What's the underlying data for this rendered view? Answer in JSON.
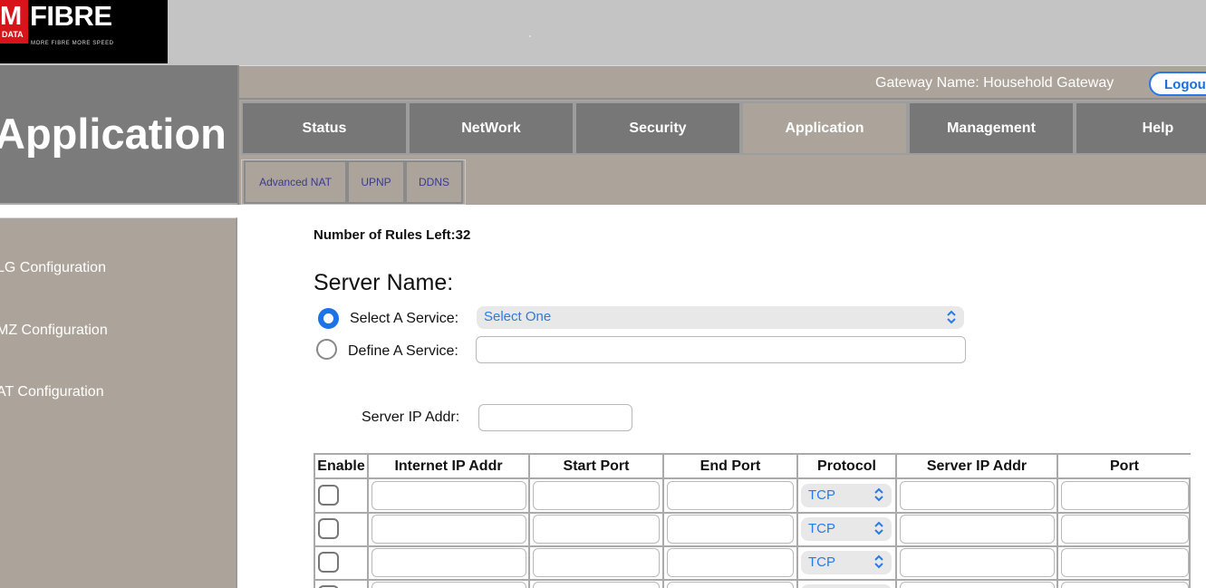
{
  "logo": {
    "brand_m": "M",
    "brand_fibre": "FIBRE",
    "brand_data": "DATA",
    "tagline": "MORE FIBRE MORE SPEED"
  },
  "header": {
    "page_title": "Application",
    "gateway_name": "Gateway Name: Household Gateway",
    "logout_label": "Logou"
  },
  "tabs": [
    {
      "label": "Status"
    },
    {
      "label": "NetWork"
    },
    {
      "label": "Security"
    },
    {
      "label": "Application"
    },
    {
      "label": "Management"
    },
    {
      "label": "Help"
    }
  ],
  "active_tab": "Application",
  "subtabs": [
    {
      "label": "Advanced NAT"
    },
    {
      "label": "UPNP"
    },
    {
      "label": "DDNS"
    }
  ],
  "sidebar": {
    "items": [
      {
        "label": "LG Configuration"
      },
      {
        "label": "MZ Configuration"
      },
      {
        "label": "AT Configuration"
      }
    ]
  },
  "form": {
    "rules_left": "Number of Rules Left:32",
    "server_name_heading": "Server Name:",
    "select_service_label": "Select A Service:",
    "select_service_value": "Select One",
    "define_service_label": "Define A Service:",
    "define_service_value": "",
    "server_ip_label": "Server IP Addr:",
    "server_ip_value": ""
  },
  "table": {
    "headers": [
      "Enable",
      "Internet IP Addr",
      "Start Port",
      "End Port",
      "Protocol",
      "Server IP Addr",
      "Port"
    ],
    "rows": [
      {
        "enabled": false,
        "protocol": "TCP"
      },
      {
        "enabled": false,
        "protocol": "TCP"
      },
      {
        "enabled": false,
        "protocol": "TCP"
      }
    ]
  },
  "colors": {
    "accent_blue": "#1c72e6",
    "tab_gray": "#777777",
    "panel_taupe": "#aca49a"
  }
}
